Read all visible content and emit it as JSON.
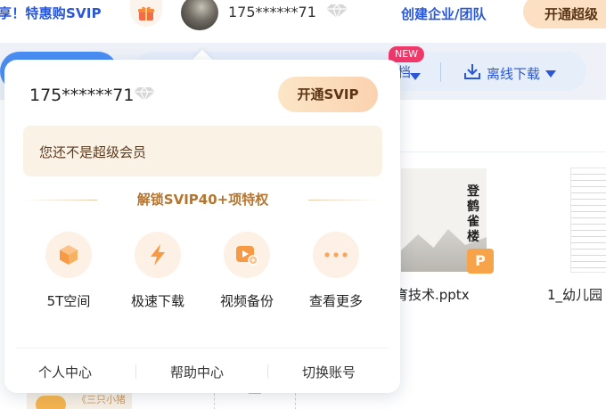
{
  "topbar": {
    "promo_text": "享！特惠购SVIP",
    "username": "175******71",
    "create_org": "创建企业/团队",
    "open_svip": "开通超级"
  },
  "toolbar": {
    "new_badge": "NEW",
    "partial_label": "档",
    "offline_download": "离线下载"
  },
  "files": [
    {
      "name": "育技术.pptx",
      "badge": "P",
      "thumb_text": "登鹤雀楼"
    },
    {
      "name": "1_幼儿园"
    }
  ],
  "bottom_thumb_text": "《三只小猪",
  "popup": {
    "username": "175******71",
    "open_svip_button": "开通SVIP",
    "not_member_text": "您还不是超级会员",
    "unlock_title": "解锁SVIP40+项特权",
    "features": [
      {
        "label": "5T空间",
        "icon": "cube-icon"
      },
      {
        "label": "极速下载",
        "icon": "lightning-icon"
      },
      {
        "label": "视频备份",
        "icon": "video-backup-icon"
      },
      {
        "label": "查看更多",
        "icon": "more-dots-icon"
      }
    ],
    "footer": {
      "personal_center": "个人中心",
      "help_center": "帮助中心",
      "switch_account": "切换账号"
    }
  },
  "colors": {
    "brand_blue": "#2a57d6",
    "svip_gold": "#b5752f",
    "feature_orange": "#f79a45",
    "new_badge_red": "#f0386b"
  }
}
